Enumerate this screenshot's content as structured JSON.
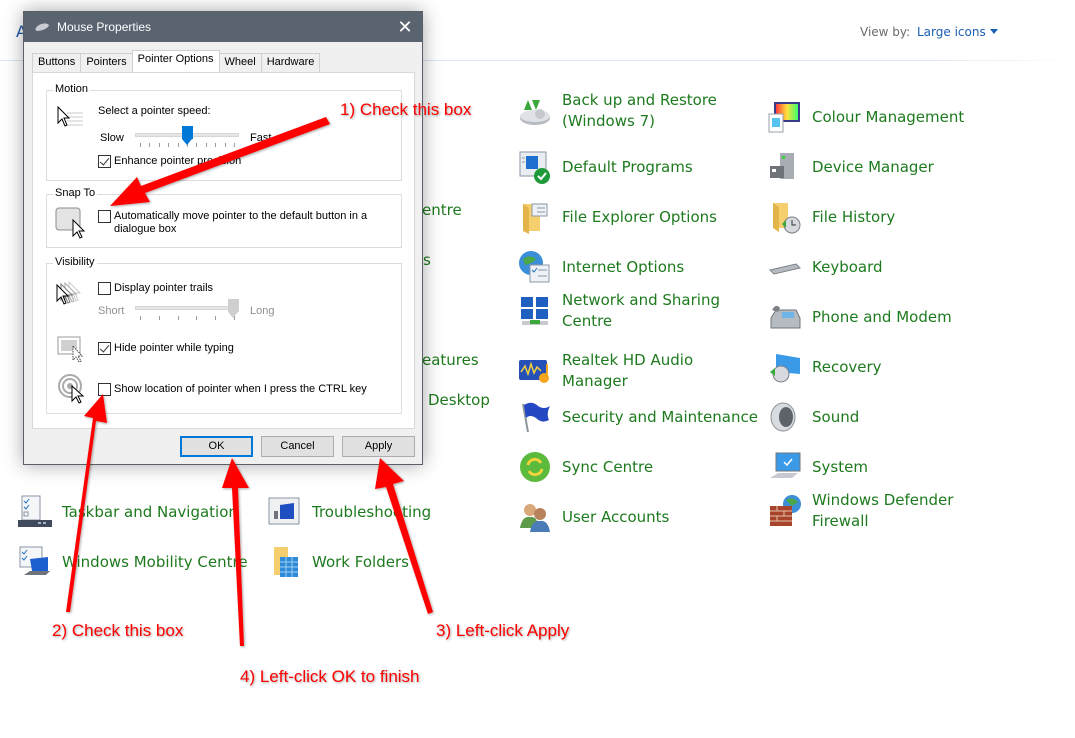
{
  "control_panel": {
    "header_left_partial": "A",
    "view_by_label": "View by:",
    "view_by_value": "Large icons",
    "partial_labels": [
      {
        "text": "entre",
        "full_hint": "Centre"
      },
      {
        "text": "s"
      },
      {
        "text": "eatures"
      },
      {
        "text": "Desktop"
      }
    ],
    "items": [
      {
        "label": "Back up and Restore (Windows 7)",
        "icon": "backup-restore-icon"
      },
      {
        "label": "Colour Management",
        "icon": "colour-management-icon"
      },
      {
        "label": "Default Programs",
        "icon": "default-programs-icon"
      },
      {
        "label": "Device Manager",
        "icon": "device-manager-icon"
      },
      {
        "label": "File Explorer Options",
        "icon": "file-explorer-options-icon"
      },
      {
        "label": "File History",
        "icon": "file-history-icon"
      },
      {
        "label": "Internet Options",
        "icon": "internet-options-icon"
      },
      {
        "label": "Keyboard",
        "icon": "keyboard-icon"
      },
      {
        "label": "Network and Sharing Centre",
        "icon": "network-sharing-icon"
      },
      {
        "label": "Phone and Modem",
        "icon": "phone-modem-icon"
      },
      {
        "label": "Realtek HD Audio Manager",
        "icon": "realtek-audio-icon"
      },
      {
        "label": "Recovery",
        "icon": "recovery-icon"
      },
      {
        "label": "Security and Maintenance",
        "icon": "security-flag-icon"
      },
      {
        "label": "Sound",
        "icon": "sound-speaker-icon"
      },
      {
        "label": "Sync Centre",
        "icon": "sync-centre-icon"
      },
      {
        "label": "System",
        "icon": "system-icon"
      },
      {
        "label": "User Accounts",
        "icon": "user-accounts-icon"
      },
      {
        "label": "Windows Defender Firewall",
        "icon": "firewall-icon"
      },
      {
        "label": "Taskbar and Navigation",
        "icon": "taskbar-icon"
      },
      {
        "label": "Troubleshooting",
        "icon": "troubleshooting-icon"
      },
      {
        "label": "Windows Mobility Centre",
        "icon": "mobility-centre-icon"
      },
      {
        "label": "Work Folders",
        "icon": "work-folders-icon"
      }
    ]
  },
  "dialog": {
    "title": "Mouse Properties",
    "close_glyph": "✕",
    "tabs": [
      {
        "label": "Buttons",
        "active": false
      },
      {
        "label": "Pointers",
        "active": false
      },
      {
        "label": "Pointer Options",
        "active": true
      },
      {
        "label": "Wheel",
        "active": false
      },
      {
        "label": "Hardware",
        "active": false
      }
    ],
    "motion": {
      "group_label": "Motion",
      "speed_label": "Select a pointer speed:",
      "slow_label": "Slow",
      "fast_label": "Fast",
      "speed_value_fraction": 0.5,
      "enhance_precision_label": "Enhance pointer precision",
      "enhance_precision_checked": true
    },
    "snap_to": {
      "group_label": "Snap To",
      "auto_move_label_line1": "Automatically move pointer to the default button in a",
      "auto_move_label_line2": "dialogue box",
      "auto_move_checked": false
    },
    "visibility": {
      "group_label": "Visibility",
      "trails_label": "Display pointer trails",
      "trails_checked": false,
      "short_label": "Short",
      "long_label": "Long",
      "trail_length_fraction": 1.0,
      "hide_typing_label": "Hide pointer while typing",
      "hide_typing_checked": true,
      "ctrl_location_label": "Show location of pointer when I press the CTRL key",
      "ctrl_location_checked": false
    },
    "buttons": {
      "ok": "OK",
      "cancel": "Cancel",
      "apply": "Apply"
    }
  },
  "annotations": {
    "color": "#ff0000",
    "notes": [
      "1) Check this box",
      "2) Check this box",
      "3) Left-click Apply",
      "4) Left-click OK to finish"
    ]
  },
  "colors": {
    "link_green": "#1e7a1e",
    "link_blue": "#1a5fb4",
    "title_bar": "#5a6370",
    "focus_blue": "#0078d7",
    "slider_active": "#0078d7",
    "slider_disabled": "#cfcfcf"
  }
}
